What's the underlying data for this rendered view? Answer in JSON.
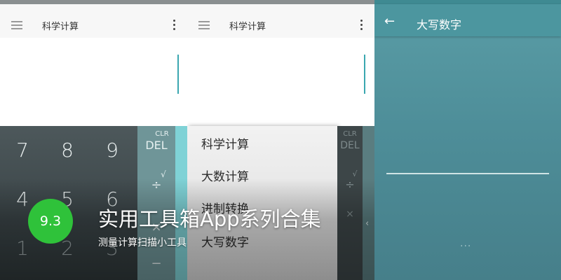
{
  "colors": {
    "accent_teal": "#3aa7b0",
    "badge_green": "#2fc23a",
    "screen3_bg": "#4e8e99"
  },
  "screen1": {
    "title": "科学计算",
    "menu_icon": "hamburger-menu-icon",
    "overflow_icon": "more-vert-icon",
    "keypad": {
      "digits": [
        "7",
        "8",
        "9",
        "4",
        "5",
        "6",
        "1",
        "2",
        "3"
      ],
      "clr_label": "CLR",
      "del_label": "DEL",
      "sqrt_label": "√",
      "divide_label": "÷",
      "multiply_label": "×",
      "minus_label": "−"
    }
  },
  "screen2": {
    "title": "科学计算",
    "menu_items": [
      "科学计算",
      "大数计算",
      "进制转换",
      "大写数字"
    ],
    "clr_label": "CLR",
    "del_label": "DEL",
    "sqrt_label": "√",
    "divide_label": "÷",
    "multiply_label": "×",
    "chevron_icon": "chevron-left-icon"
  },
  "screen3": {
    "title": "大写数字",
    "back_icon": "arrow-back-icon",
    "more_dots": "..."
  },
  "overlay": {
    "rating": "9.3",
    "headline": "实用工具箱App系列合集",
    "subline": "测量计算扫描小工具"
  }
}
